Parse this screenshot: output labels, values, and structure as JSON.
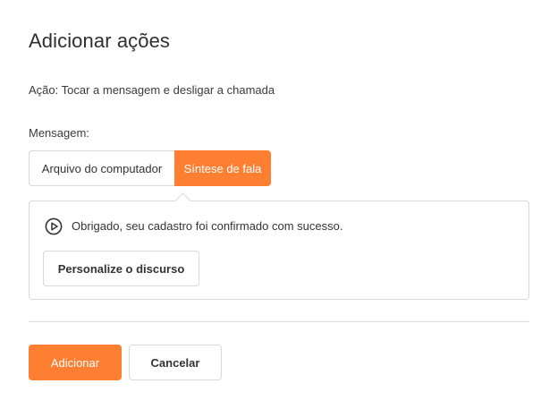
{
  "dialog": {
    "title": "Adicionar ações",
    "action_description": "Ação: Tocar a mensagem e desligar a chamada"
  },
  "message": {
    "label": "Mensagem:",
    "source_options": [
      {
        "label": "Arquivo do computador",
        "selected": false
      },
      {
        "label": "Síntese de fala",
        "selected": true
      }
    ],
    "speech_text": "Obrigado, seu cadastro foi confirmado com sucesso.",
    "play_icon": "play-circle-icon",
    "customize_label": "Personalize o discurso"
  },
  "footer": {
    "add_label": "Adicionar",
    "cancel_label": "Cancelar"
  },
  "colors": {
    "accent": "#ff7f32",
    "border": "#d9d9d9",
    "text": "#333333"
  }
}
